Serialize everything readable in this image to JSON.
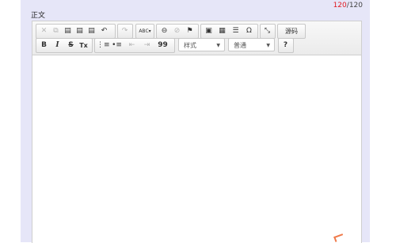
{
  "counter": {
    "current": "120",
    "separator": "/",
    "max": "120"
  },
  "section_title": "正文",
  "toolbar": {
    "cut": "✕",
    "copy": "⧉",
    "paste": "▤",
    "paste_text": "▤",
    "paste_word": "▤",
    "undo": "↶",
    "redo": "↷",
    "spellcheck": "ABC▾",
    "link": "⊖",
    "unlink": "⊘",
    "anchor": "⚑",
    "image": "▣",
    "table": "▦",
    "hr": "☰",
    "special_char": "Ω",
    "maximize": "⤡",
    "source": "源码",
    "bold": "B",
    "italic": "I",
    "strike": "S",
    "remove_format": "Tx",
    "numbered_list": "⋮≡",
    "bulleted_list": "•≡",
    "outdent": "⇤",
    "indent": "⇥",
    "blockquote": "99",
    "styles_combo": "样式",
    "format_combo": "普通",
    "help": "?"
  },
  "colors": {
    "accent_red": "#e0191f",
    "panel_bg": "#e6e6f8"
  }
}
